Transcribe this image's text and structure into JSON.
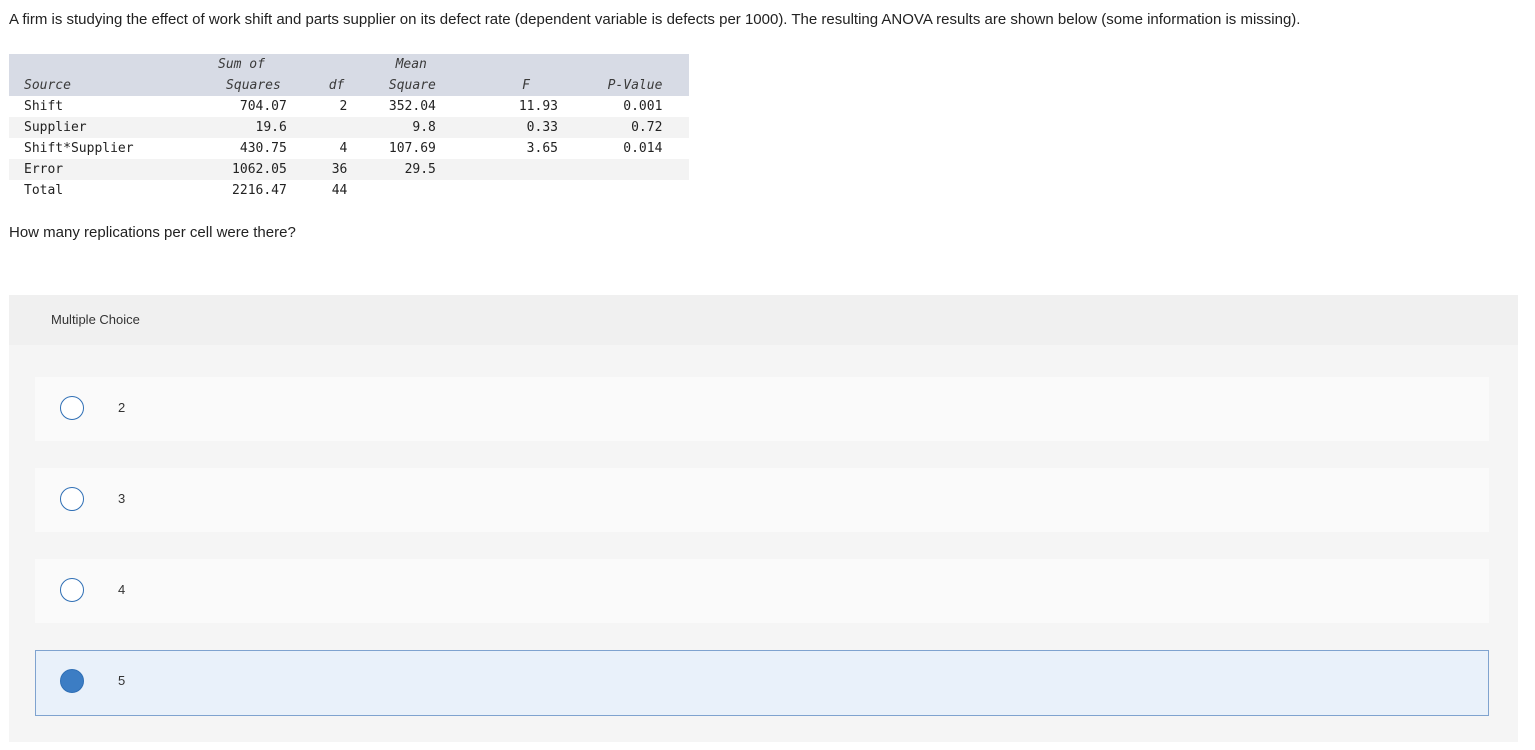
{
  "question": {
    "intro": "A firm is studying the effect of work shift and parts supplier on its defect rate (dependent variable is defects per 1000). The resulting ANOVA results are shown below (some information is missing).",
    "prompt": "How many replications per cell were there?"
  },
  "anova": {
    "headers": {
      "source": "Source",
      "ss_line1": "Sum of",
      "ss_line2": "Squares",
      "df": "df",
      "ms_line1": "Mean",
      "ms_line2": "Square",
      "f": "F",
      "p": "P-Value"
    },
    "rows": [
      {
        "source": "Shift",
        "ss": "704.07",
        "df": "2",
        "ms": "352.04",
        "f": "11.93",
        "p": "0.001"
      },
      {
        "source": "Supplier",
        "ss": "19.6",
        "df": "",
        "ms": "9.8",
        "f": "0.33",
        "p": "0.72"
      },
      {
        "source": "Shift*Supplier",
        "ss": "430.75",
        "df": "4",
        "ms": "107.69",
        "f": "3.65",
        "p": "0.014"
      },
      {
        "source": "Error",
        "ss": "1062.05",
        "df": "36",
        "ms": "29.5",
        "f": "",
        "p": ""
      },
      {
        "source": "Total",
        "ss": "2216.47",
        "df": "44",
        "ms": "",
        "f": "",
        "p": ""
      }
    ]
  },
  "multiple_choice": {
    "label": "Multiple Choice",
    "options": [
      {
        "label": "2",
        "selected": false
      },
      {
        "label": "3",
        "selected": false
      },
      {
        "label": "4",
        "selected": false
      },
      {
        "label": "5",
        "selected": true
      }
    ]
  },
  "colors": {
    "accent": "#3c7dc4",
    "selected_bg": "#e9f1fa",
    "table_header_bg": "#d7dbe5"
  }
}
